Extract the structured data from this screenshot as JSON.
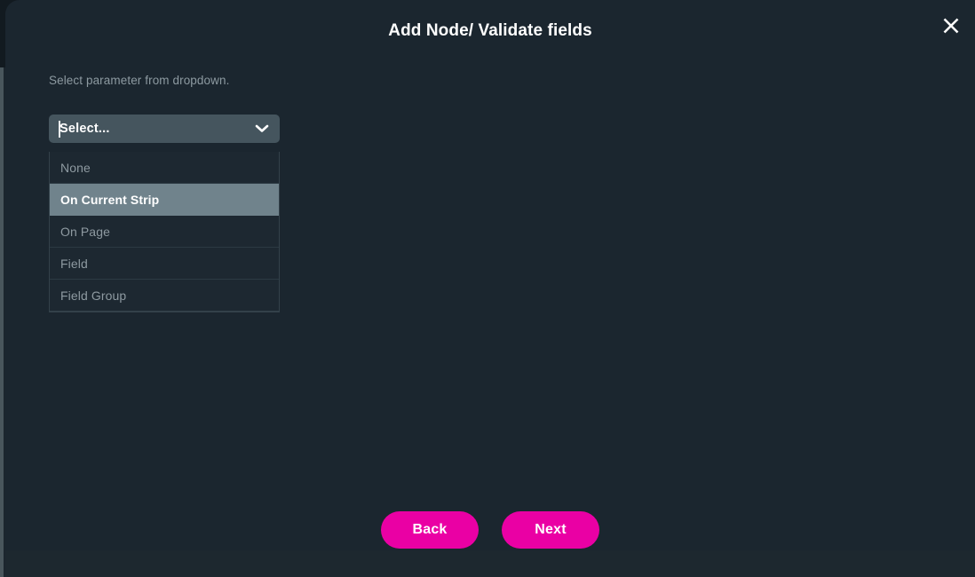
{
  "colors": {
    "modal_background": "#1b262f",
    "backdrop": "#121a20",
    "select_background": "#45555e",
    "menu_background": "#1d2831",
    "highlight": "#70838c",
    "accent_magenta": "#ea00a4",
    "title_text": "#ffffff",
    "muted_text": "#8d9aa1"
  },
  "modal": {
    "title": "Add Node/ Validate fields",
    "close_icon": "close-icon"
  },
  "form": {
    "label": "Select parameter from dropdown.",
    "select": {
      "placeholder": "Select...",
      "value": "Select...",
      "chevron_icon": "chevron-down-icon",
      "expanded": true,
      "options": [
        {
          "label": "None",
          "highlighted": false
        },
        {
          "label": "On Current Strip",
          "highlighted": true
        },
        {
          "label": "On Page",
          "highlighted": false
        },
        {
          "label": "Field",
          "highlighted": false
        },
        {
          "label": "Field Group",
          "highlighted": false
        }
      ]
    }
  },
  "footer": {
    "back_label": "Back",
    "next_label": "Next"
  }
}
